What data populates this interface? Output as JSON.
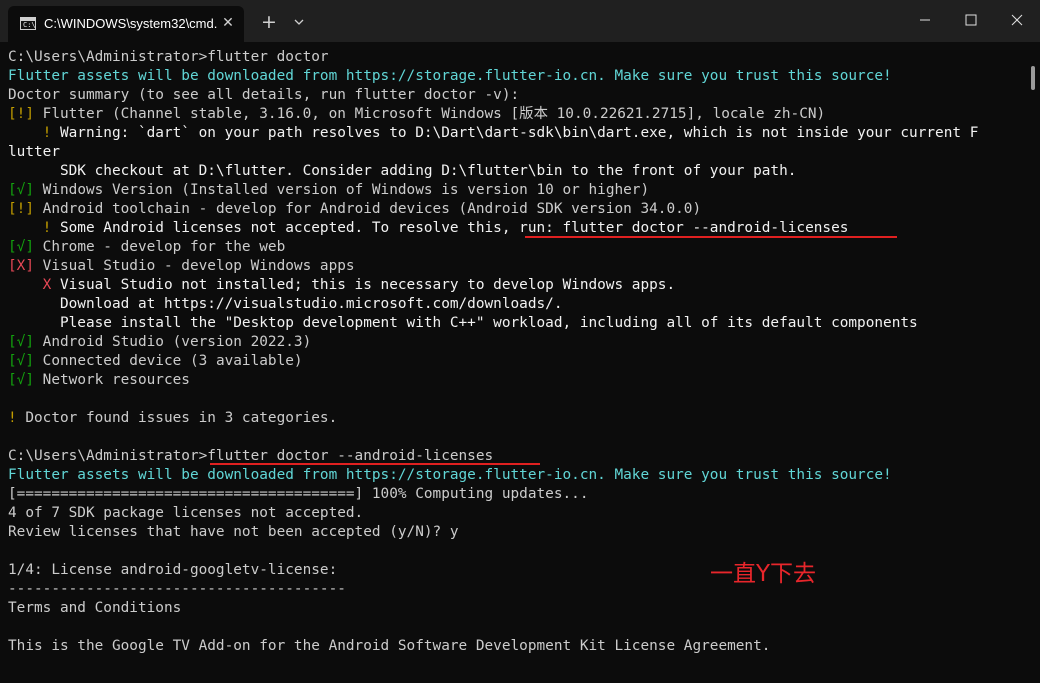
{
  "window": {
    "tab_title": "C:\\WINDOWS\\system32\\cmd.",
    "tab_icon_text": "C:\\"
  },
  "console": {
    "l1": "C:\\Users\\Administrator>flutter doctor",
    "l2": "Flutter assets will be downloaded from https://storage.flutter-io.cn. Make sure you trust this source!",
    "l3": "Doctor summary (to see all details, run flutter doctor -v):",
    "l4_mark": "[!]",
    "l4_text": " Flutter (Channel stable, 3.16.0, on Microsoft Windows [版本 10.0.22621.2715], locale zh-CN)",
    "l5_mark": "    ! ",
    "l5_text": "Warning: `dart` on your path resolves to D:\\Dart\\dart-sdk\\bin\\dart.exe, which is not inside your current F",
    "l6": "lutter",
    "l7": "      SDK checkout at D:\\flutter. Consider adding D:\\flutter\\bin to the front of your path.",
    "l8_mark": "[√]",
    "l8_text": " Windows Version (Installed version of Windows is version 10 or higher)",
    "l9_mark": "[!]",
    "l9_text": " Android toolchain - develop for Android devices (Android SDK version 34.0.0)",
    "l10_mark": "    ! ",
    "l10_text": "Some Android licenses not accepted. To resolve this, run: flutter doctor --android-licenses",
    "l11_mark": "[√]",
    "l11_text": " Chrome - develop for the web",
    "l12_mark": "[X]",
    "l12_text": " Visual Studio - develop Windows apps",
    "l13_mark": "    X ",
    "l13_text": "Visual Studio not installed; this is necessary to develop Windows apps.",
    "l14": "      Download at https://visualstudio.microsoft.com/downloads/.",
    "l15": "      Please install the \"Desktop development with C++\" workload, including all of its default components",
    "l16_mark": "[√]",
    "l16_text": " Android Studio (version 2022.3)",
    "l17_mark": "[√]",
    "l17_text": " Connected device (3 available)",
    "l18_mark": "[√]",
    "l18_text": " Network resources",
    "l19_mark": "! ",
    "l19_text": "Doctor found issues in 3 categories.",
    "l20": "C:\\Users\\Administrator>flutter doctor --android-licenses",
    "l21": "Flutter assets will be downloaded from https://storage.flutter-io.cn. Make sure you trust this source!",
    "l22": "[=======================================] 100% Computing updates...",
    "l23": "4 of 7 SDK package licenses not accepted.",
    "l24": "Review licenses that have not been accepted (y/N)? y",
    "l25": "1/4: License android-googletv-license:",
    "l26": "---------------------------------------",
    "l27": "Terms and Conditions",
    "l28": "This is the Google TV Add-on for the Android Software Development Kit License Agreement."
  },
  "annotation": {
    "note": "一直Y下去",
    "color": "#e8262b"
  },
  "colors": {
    "background": "#0c0c0c",
    "titlebar": "#202020",
    "cyan": "#61d6d6",
    "yellow": "#c19c00",
    "green": "#13a10e",
    "red": "#e74856"
  }
}
